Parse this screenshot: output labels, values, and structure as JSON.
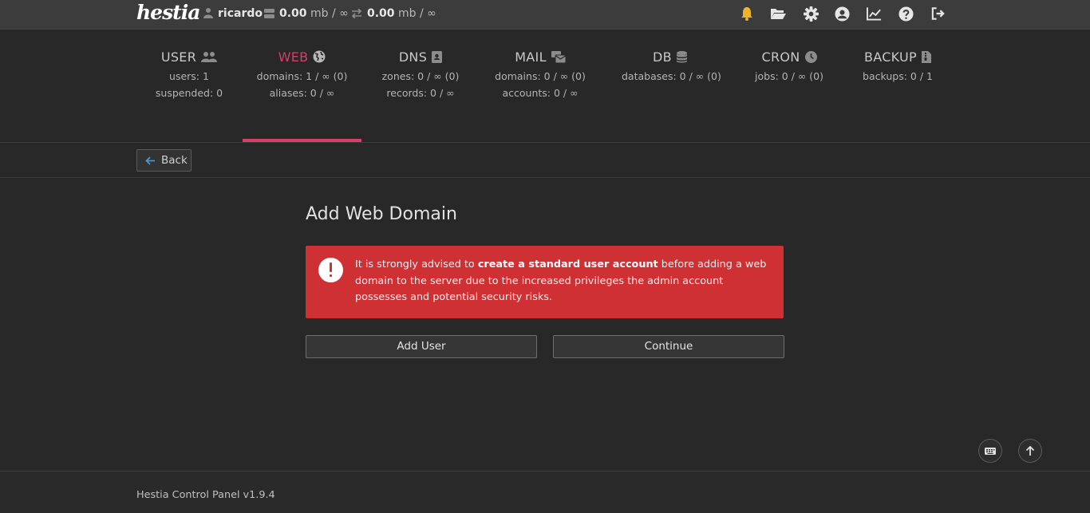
{
  "app": {
    "logo_text": "hestia",
    "user_name": "ricardo",
    "disk_value": "0.00",
    "disk_unit": "mb / ∞",
    "bandwidth_value": "0.00",
    "bandwidth_unit": "mb / ∞"
  },
  "top_icons": [
    "bell-icon",
    "folder-open-icon",
    "gear-icon",
    "user-circle-icon",
    "chart-line-icon",
    "question-icon",
    "sign-out-icon"
  ],
  "tabs": [
    {
      "title": "USER",
      "icon": "users-icon",
      "lines": [
        "users: 1",
        "suspended: 0"
      ]
    },
    {
      "title": "WEB",
      "icon": "globe-icon",
      "lines": [
        "domains: 1 / ∞ (0)",
        "aliases: 0 / ∞"
      ],
      "active": true
    },
    {
      "title": "DNS",
      "icon": "address-book-icon",
      "lines": [
        "zones: 0 / ∞ (0)",
        "records: 0 / ∞"
      ]
    },
    {
      "title": "MAIL",
      "icon": "mail-bulk-icon",
      "lines": [
        "domains: 0 / ∞ (0)",
        "accounts: 0 / ∞"
      ]
    },
    {
      "title": "DB",
      "icon": "database-icon",
      "lines": [
        "databases: 0 / ∞ (0)"
      ]
    },
    {
      "title": "CRON",
      "icon": "clock-icon",
      "lines": [
        "jobs: 0 / ∞ (0)"
      ]
    },
    {
      "title": "BACKUP",
      "icon": "file-archive-icon",
      "lines": [
        "backups: 0 / 1"
      ]
    }
  ],
  "toolbar": {
    "back_label": "Back"
  },
  "main": {
    "title": "Add Web Domain",
    "alert_prefix": "It is strongly advised to ",
    "alert_bold": "create a standard user account",
    "alert_suffix": " before adding a web domain to the server due to the increased privileges the admin account possesses and potential security risks.",
    "add_user_label": "Add User",
    "continue_label": "Continue"
  },
  "footer": {
    "text": "Hestia Control Panel v1.9.4"
  },
  "colors": {
    "accent": "#d43f6b",
    "alert_bg": "#cf3033",
    "bell": "#f0b429",
    "back_arrow": "#3a9ad9"
  }
}
